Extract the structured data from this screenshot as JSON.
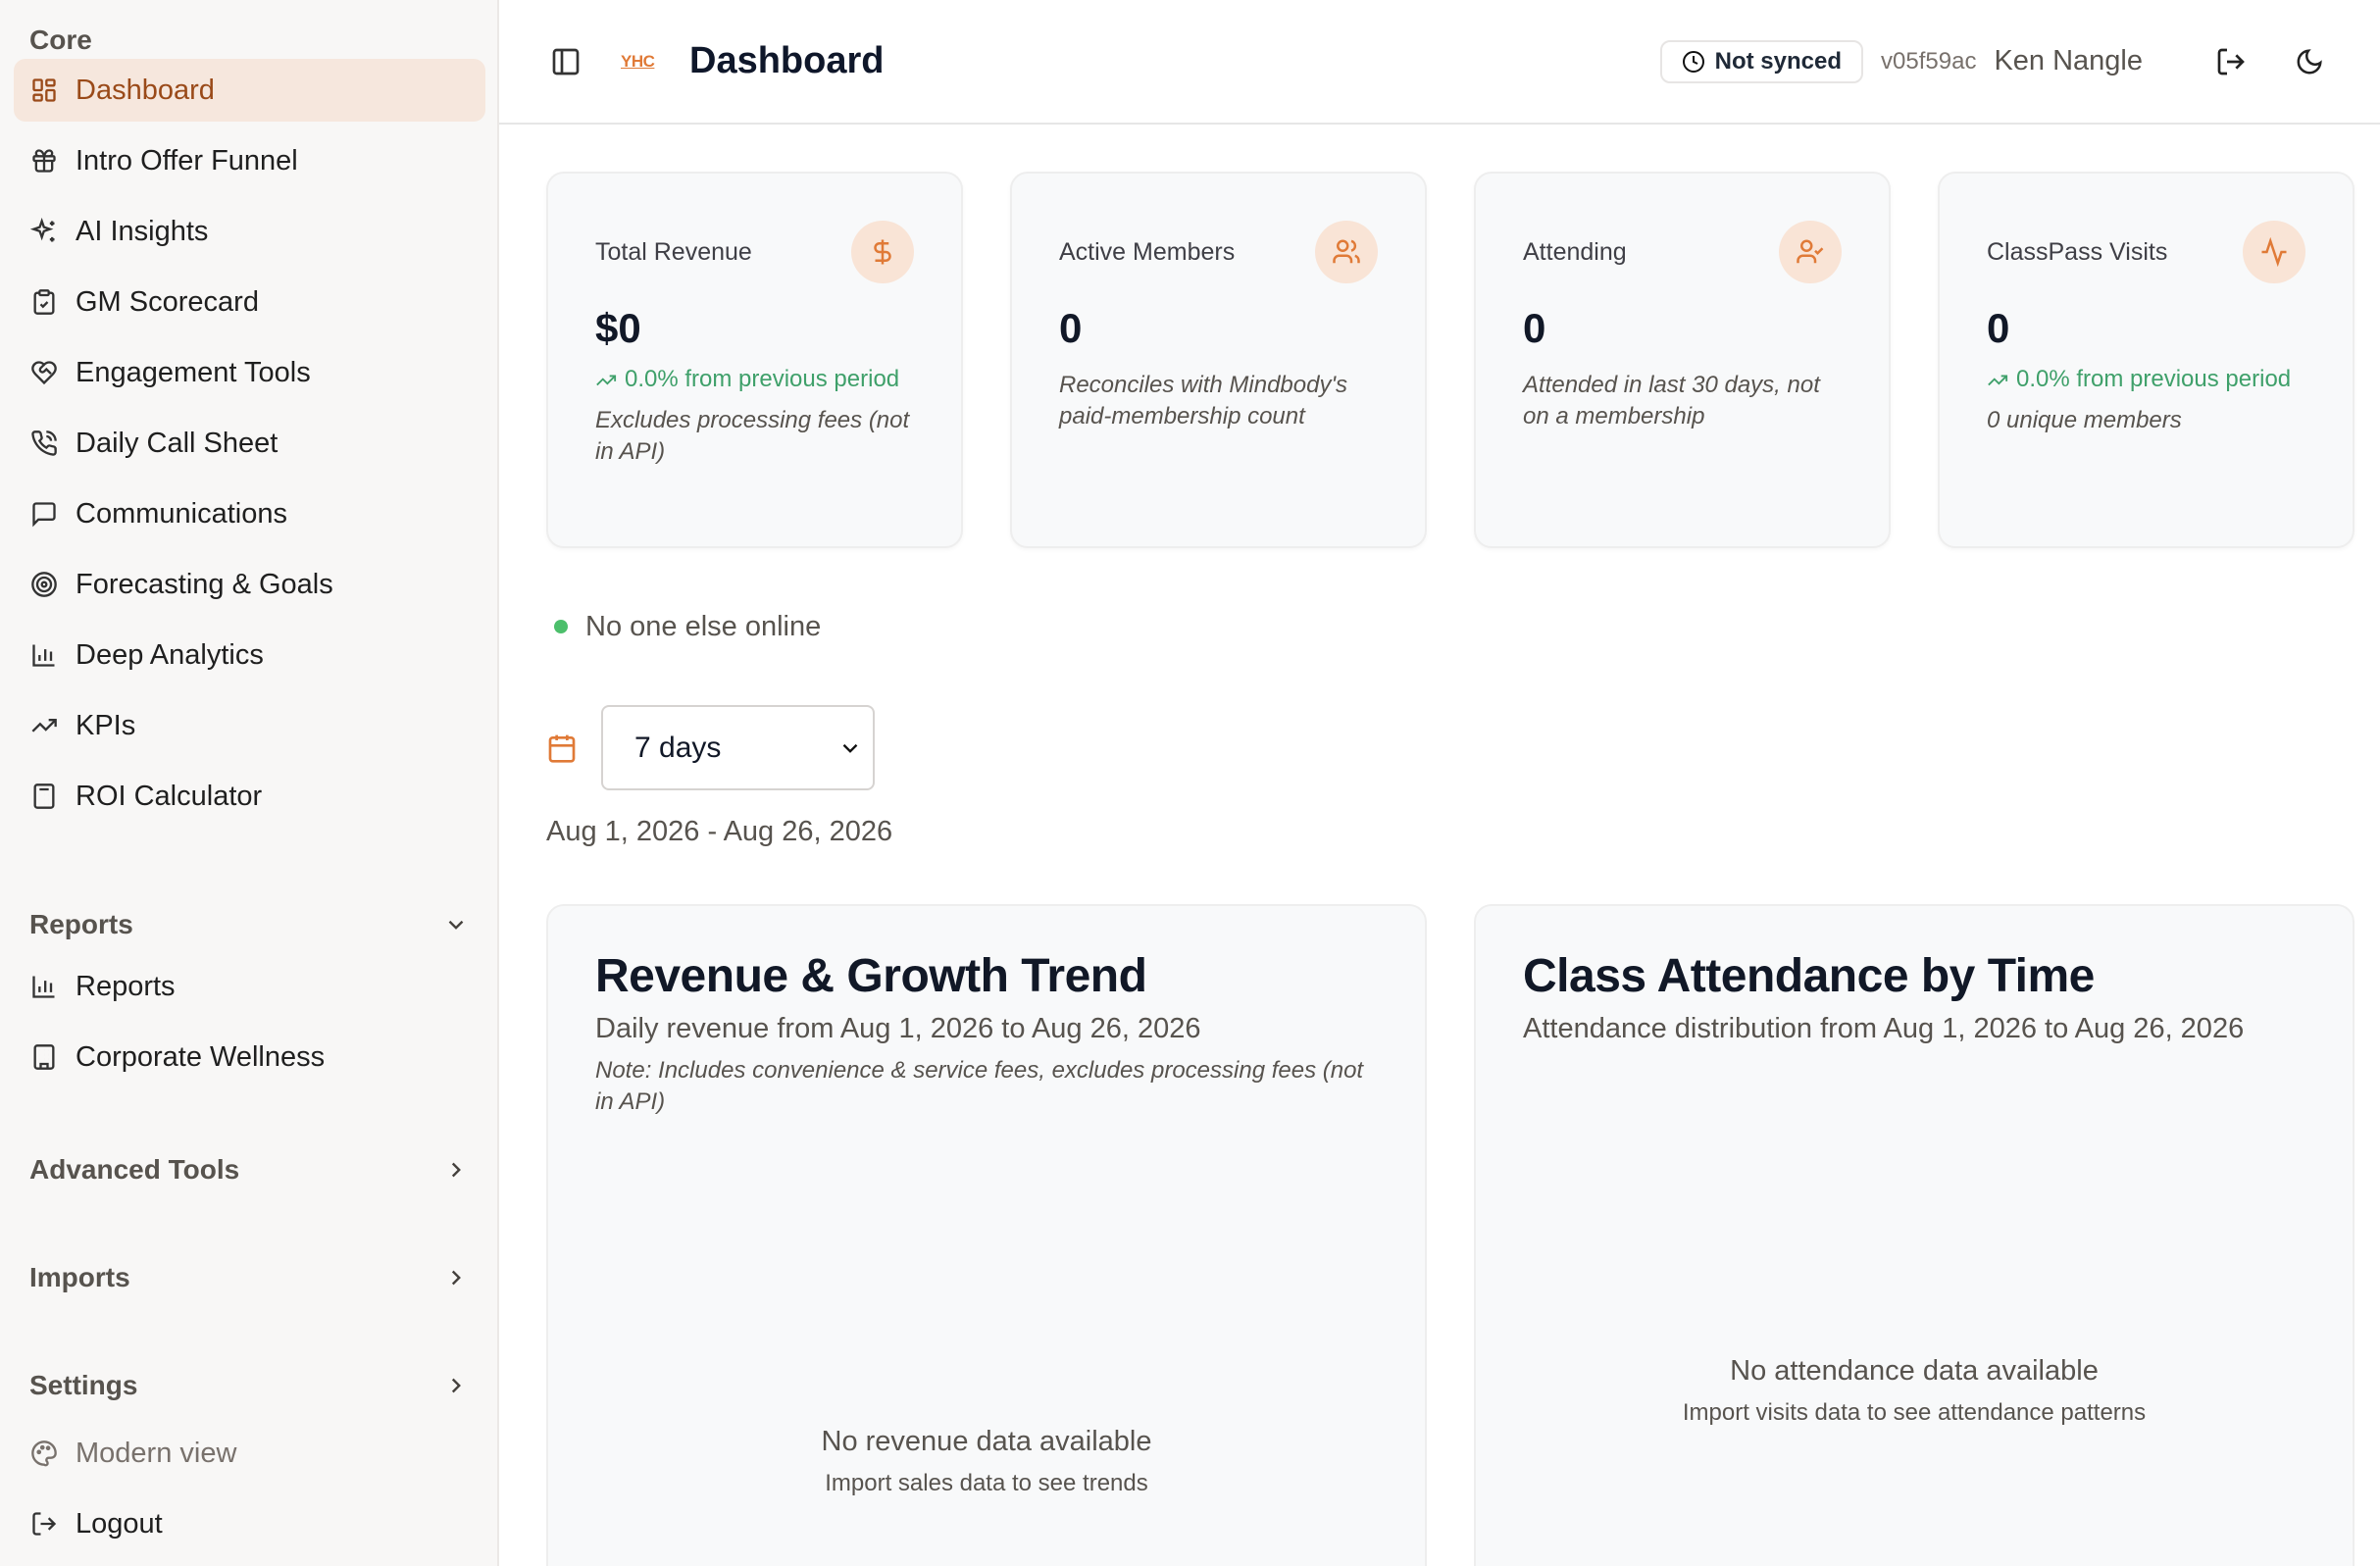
{
  "sidebar": {
    "core_label": "Core",
    "core_items": [
      {
        "label": "Dashboard",
        "icon": "layout-dashboard-icon"
      },
      {
        "label": "Intro Offer Funnel",
        "icon": "gift-icon"
      },
      {
        "label": "AI Insights",
        "icon": "sparkles-icon"
      },
      {
        "label": "GM Scorecard",
        "icon": "clipboard-check-icon"
      },
      {
        "label": "Engagement Tools",
        "icon": "heart-handshake-icon"
      },
      {
        "label": "Daily Call Sheet",
        "icon": "phone-call-icon"
      },
      {
        "label": "Communications",
        "icon": "message-square-icon"
      },
      {
        "label": "Forecasting & Goals",
        "icon": "target-icon"
      },
      {
        "label": "Deep Analytics",
        "icon": "bar-chart-icon"
      },
      {
        "label": "KPIs",
        "icon": "trending-up-icon"
      },
      {
        "label": "ROI Calculator",
        "icon": "calculator-icon"
      }
    ],
    "reports_label": "Reports",
    "reports_items": [
      {
        "label": "Reports",
        "icon": "bar-chart-icon"
      },
      {
        "label": "Corporate Wellness",
        "icon": "building-icon"
      }
    ],
    "advanced_label": "Advanced Tools",
    "imports_label": "Imports",
    "settings_label": "Settings",
    "modern_view_label": "Modern view",
    "logout_label": "Logout"
  },
  "topbar": {
    "logo_text": "YHC",
    "title": "Dashboard",
    "sync_status": "Not synced",
    "version": "v05f59ac",
    "user_name": "Ken Nangle"
  },
  "stats": [
    {
      "label": "Total Revenue",
      "value": "$0",
      "trend": "0.0% from previous period",
      "note": "Excludes processing fees (not in API)",
      "icon": "dollar-sign-icon"
    },
    {
      "label": "Active Members",
      "value": "0",
      "note": "Reconciles with Mindbody's paid-membership count",
      "icon": "users-icon"
    },
    {
      "label": "Attending",
      "value": "0",
      "note": "Attended in last 30 days, not on a membership",
      "icon": "user-check-icon"
    },
    {
      "label": "ClassPass Visits",
      "value": "0",
      "trend": "0.0% from previous period",
      "note": "0 unique members",
      "icon": "activity-icon"
    }
  ],
  "presence": {
    "text": "No one else online"
  },
  "period": {
    "selected": "7 days",
    "range": "Aug 1, 2026 - Aug 26, 2026"
  },
  "revenue_chart": {
    "title": "Revenue & Growth Trend",
    "subtitle": "Daily revenue from Aug 1, 2026 to Aug 26, 2026",
    "note": "Note: Includes convenience & service fees, excludes processing fees (not in API)",
    "empty_title": "No revenue data available",
    "empty_hint": "Import sales data to see trends"
  },
  "attendance_chart": {
    "title": "Class Attendance by Time",
    "subtitle": "Attendance distribution from Aug 1, 2026 to Aug 26, 2026",
    "empty_title": "No attendance data available",
    "empty_hint": "Import visits data to see attendance patterns"
  },
  "colors": {
    "accent": "#e07a37",
    "active_bg": "#f6e7dd",
    "success": "#3fa06a"
  }
}
